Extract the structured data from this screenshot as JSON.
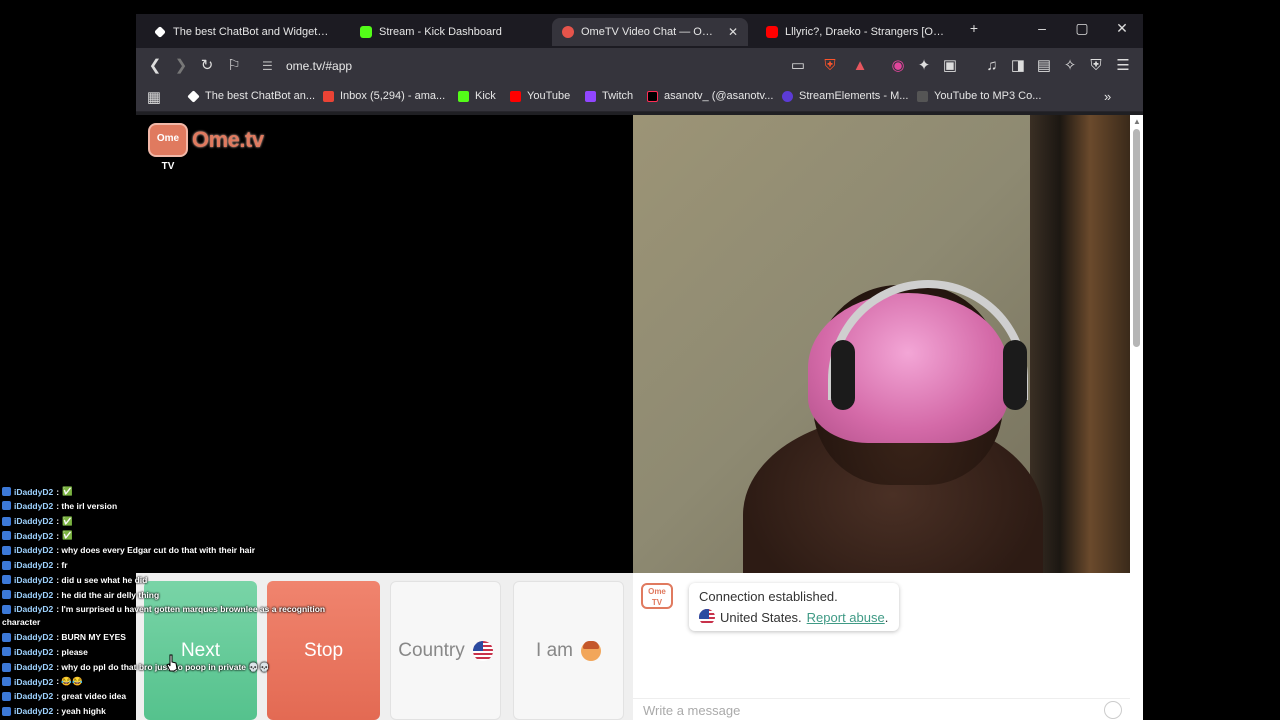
{
  "browser": {
    "tabs": [
      {
        "title": "The best ChatBot and Widgets for",
        "color": "#ffffff",
        "active": false
      },
      {
        "title": "Stream - Kick Dashboard",
        "color": "#53fc18",
        "active": false
      },
      {
        "title": "OmeTV Video Chat — Ome",
        "color": "#e5544b",
        "active": true
      },
      {
        "title": "Lllyric?, Draeko - Strangers [Officia",
        "color": "#ff0000",
        "active": false
      }
    ],
    "tab_close_glyph": "✕",
    "new_tab_glyph": "+",
    "url": "ome.tv/#app",
    "bookmarks": [
      {
        "label": "The best ChatBot an...",
        "color": "#ffffff"
      },
      {
        "label": "Inbox (5,294) - ama...",
        "color": "#ea4335"
      },
      {
        "label": "Kick",
        "color": "#53fc18"
      },
      {
        "label": "YouTube",
        "color": "#ff0000"
      },
      {
        "label": "Twitch",
        "color": "#9146ff"
      },
      {
        "label": "asanotv_ (@asanotv...",
        "color": "#000000"
      },
      {
        "label": "StreamElements - M...",
        "color": "#5c3bd6"
      },
      {
        "label": "YouTube to MP3 Co...",
        "color": "#222222"
      }
    ],
    "bookmarks_overflow": "»",
    "shield_count": "2",
    "alert_count": "1"
  },
  "logo": {
    "badge": "Ome TV",
    "word": "Ome.tv"
  },
  "controls": {
    "next": "Next",
    "stop": "Stop",
    "country": "Country",
    "iam": "I am"
  },
  "chat_panel": {
    "badge_top": "Ome",
    "badge_bottom": "TV",
    "connection_title": "Connection established.",
    "country": "United States.",
    "report": "Report abuse",
    "report_suffix": ".",
    "input_placeholder": "Write a message"
  },
  "stream_chat": [
    {
      "user": "iDaddyD2",
      "text": ":",
      "check": true
    },
    {
      "user": "iDaddyD2",
      "text": ": the irl version",
      "check": false
    },
    {
      "user": "iDaddyD2",
      "text": ":",
      "check": true
    },
    {
      "user": "iDaddyD2",
      "text": ":",
      "check": true
    },
    {
      "user": "iDaddyD2",
      "text": ": why does every Edgar cut do that with their hair",
      "check": false
    },
    {
      "user": "iDaddyD2",
      "text": ": fr",
      "check": false
    },
    {
      "user": "iDaddyD2",
      "text": ": did u see what he did",
      "check": false
    },
    {
      "user": "iDaddyD2",
      "text": ": he did the air delly thing",
      "check": false
    },
    {
      "user": "iDaddyD2",
      "text": ": I'm surprised u havent gotten marques brownlee as a recognition",
      "check": false,
      "continuation": "character"
    },
    {
      "user": "iDaddyD2",
      "text": ": BURN MY EYES",
      "check": false
    },
    {
      "user": "iDaddyD2",
      "text": ": please",
      "check": false
    },
    {
      "user": "iDaddyD2",
      "text": ": why do ppl do that bro just go poop in private 💀💀",
      "check": false
    },
    {
      "user": "iDaddyD2",
      "text": ": 😂😂",
      "check": false
    },
    {
      "user": "iDaddyD2",
      "text": ": great video idea",
      "check": false
    },
    {
      "user": "iDaddyD2",
      "text": ": yeah highk",
      "check": false
    }
  ]
}
